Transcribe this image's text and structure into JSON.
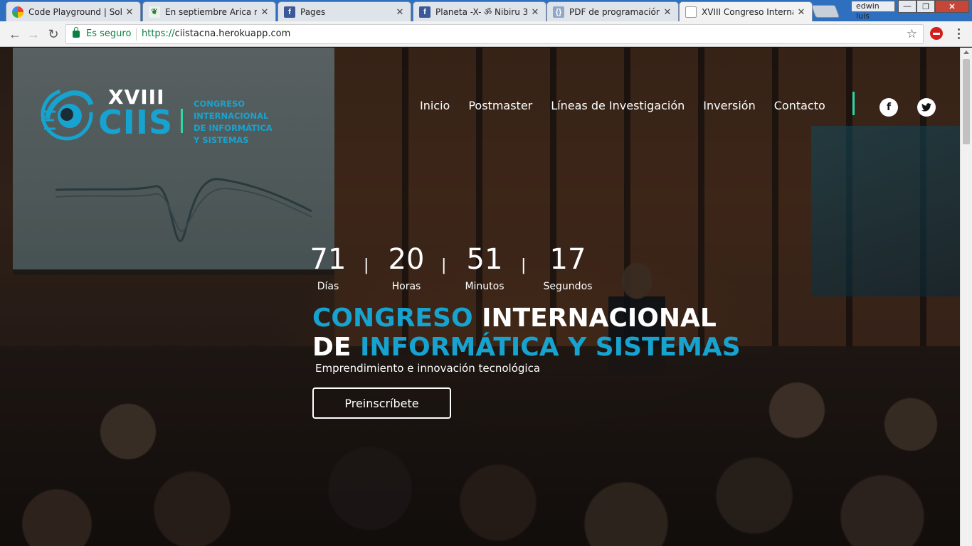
{
  "browser": {
    "tabs": [
      {
        "title": "Code Playground | Solo",
        "icon": "google-photos-icon",
        "active": false
      },
      {
        "title": "En septiembre Arica rec",
        "icon": "leaf-icon",
        "active": false
      },
      {
        "title": "Pages",
        "icon": "facebook-icon",
        "active": false
      },
      {
        "title": "Planeta -X- ॐ Nibiru 3",
        "icon": "facebook-icon",
        "active": false
      },
      {
        "title": "PDF de programación -",
        "icon": "document-icon",
        "active": false
      },
      {
        "title": "XVIII Congreso Internac",
        "icon": "page-icon",
        "active": true
      }
    ],
    "user": "edwin luis",
    "security_label": "Es seguro",
    "url_scheme": "https://",
    "url_host": "ciistacna.herokuapp.com"
  },
  "site": {
    "logo": {
      "roman": "XVIII",
      "name": "CIIS",
      "caption": [
        "CONGRESO",
        "INTERNACIONAL",
        "DE INFORMÁTICA",
        "Y SISTEMAS"
      ]
    },
    "nav": [
      "Inicio",
      "Postmaster",
      "Líneas de Investigación",
      "Inversión",
      "Contacto"
    ],
    "social": [
      {
        "name": "facebook",
        "glyph": "f"
      },
      {
        "name": "twitter",
        "glyph": "t"
      }
    ],
    "countdown": [
      {
        "value": "71",
        "label": "Días"
      },
      {
        "value": "20",
        "label": "Horas"
      },
      {
        "value": "51",
        "label": "Minutos"
      },
      {
        "value": "17",
        "label": "Segundos"
      }
    ],
    "countdown_separator": "|",
    "hero": {
      "line1_accent": "CONGRESO",
      "line1_rest": " INTERNACIONAL",
      "line2_start": "DE ",
      "line2_accent": "INFORMÁTICA Y SISTEMAS",
      "subtitle": "Emprendimiento e innovación tecnológica",
      "cta": "Preinscríbete"
    },
    "colors": {
      "accent": "#17a3cf",
      "green": "#2fd7a5"
    }
  }
}
